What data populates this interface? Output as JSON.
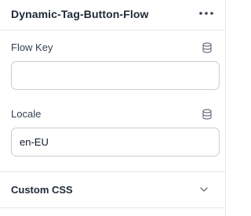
{
  "panel": {
    "title": "Dynamic-Tag-Button-Flow",
    "more_icon": "more-horizontal-icon"
  },
  "fields": [
    {
      "label": "Flow Key",
      "value": "",
      "icon": "database-icon"
    },
    {
      "label": "Locale",
      "value": "en-EU",
      "icon": "database-icon"
    }
  ],
  "sections": [
    {
      "title": "Custom CSS",
      "icon": "chevron-down-icon",
      "expanded": false
    }
  ],
  "colors": {
    "text": "#1f2937",
    "border": "#c8ccd2",
    "divider": "#e6e7ea",
    "icon": "#6b7280"
  }
}
